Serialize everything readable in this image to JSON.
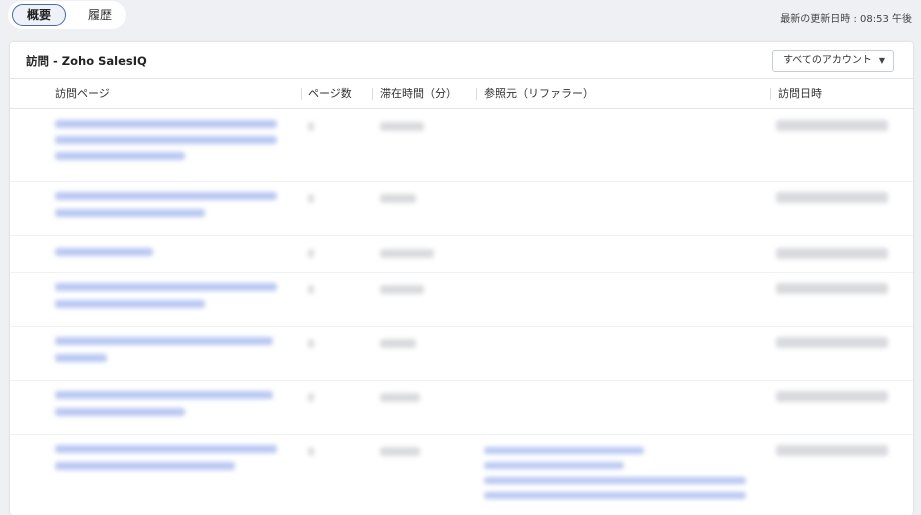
{
  "tabs": [
    {
      "label": "概要",
      "active": true
    },
    {
      "label": "履歴",
      "active": false
    }
  ],
  "last_updated": "最新の更新日時 : 08:53 午後",
  "card": {
    "title": "訪問 - Zoho SalesIQ",
    "account_filter": "すべてのアカウント",
    "columns": [
      "訪問ページ",
      "ページ数",
      "滞在時間（分）",
      "参照元（リファラー）",
      "訪問日時"
    ]
  },
  "rows_count_note": "",
  "colors": {
    "accent_border": "#4a6aa3",
    "blurred_link": "#b9c8f2",
    "blurred_text": "#d9dadd"
  }
}
